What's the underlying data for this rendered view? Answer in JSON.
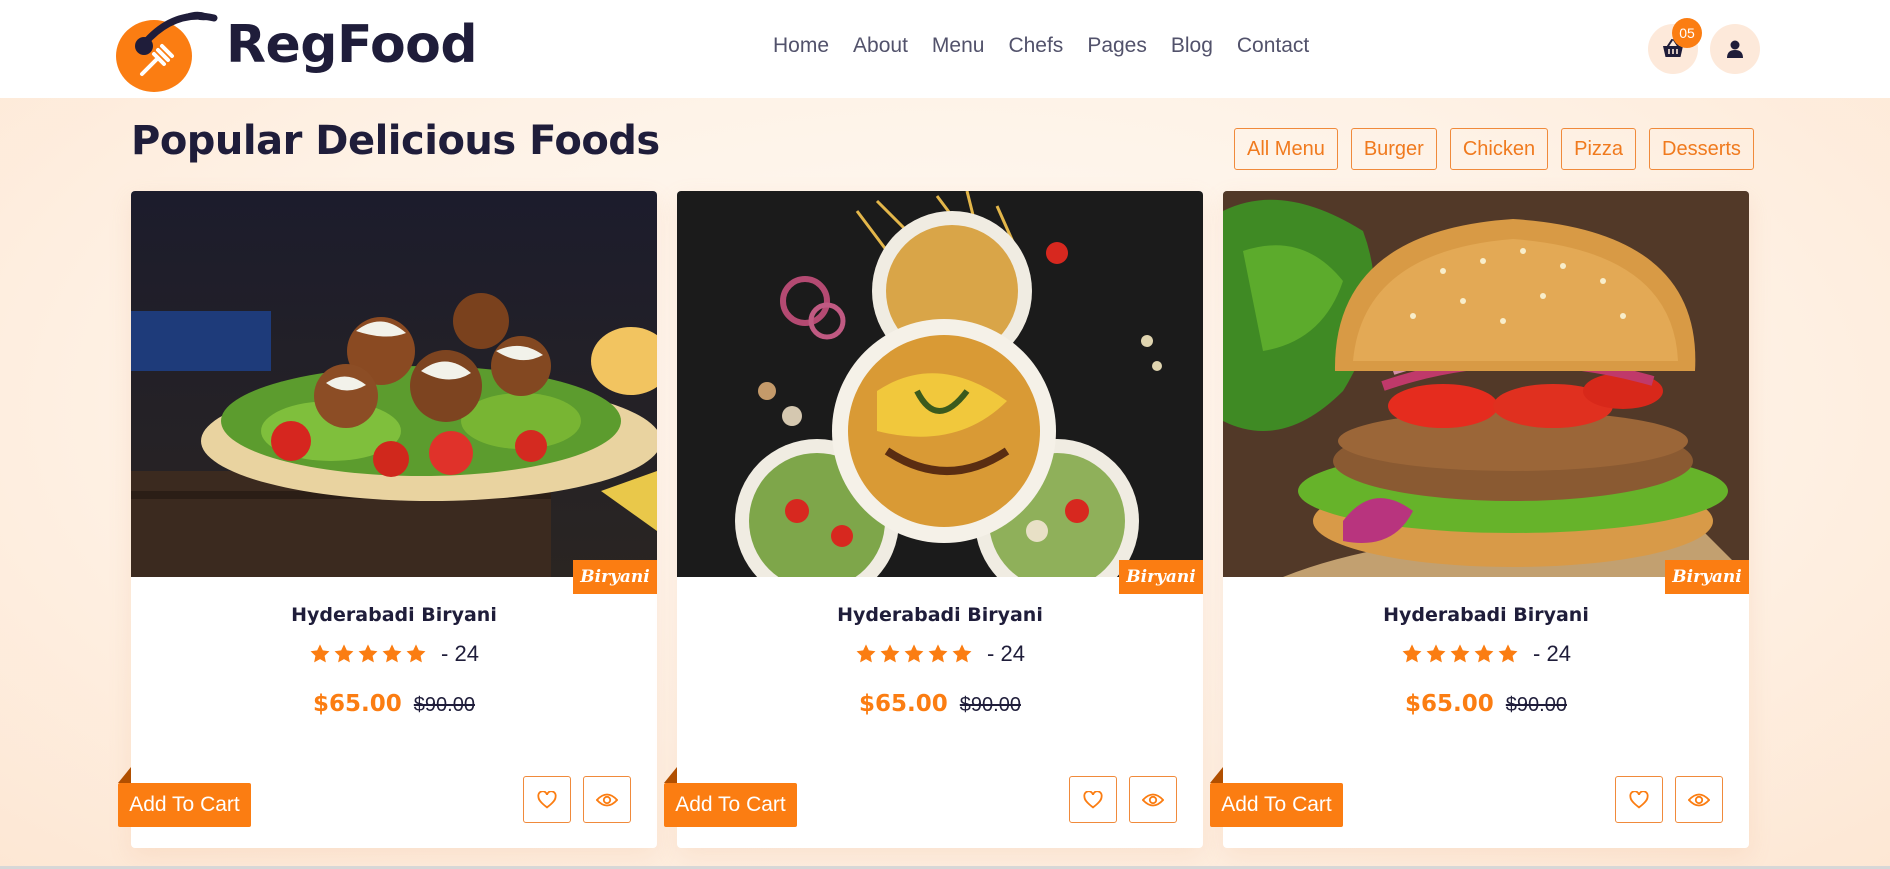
{
  "header": {
    "brand": "RegFood",
    "nav": [
      "Home",
      "About",
      "Menu",
      "Chefs",
      "Pages",
      "Blog",
      "Contact"
    ],
    "cart_count": "05",
    "icons": {
      "cart": "basket-icon",
      "user": "user-icon"
    }
  },
  "section": {
    "title": "Popular Delicious Foods",
    "filters": [
      "All Menu",
      "Burger",
      "Chicken",
      "Pizza",
      "Desserts"
    ]
  },
  "cards": [
    {
      "tag": "Biryani",
      "title": "Hyderabadi Biryani",
      "stars": 5,
      "rating_count": "- 24",
      "price": "$65.00",
      "old_price": "$90.00",
      "cta": "Add To Cart",
      "image": "falafel-wrap"
    },
    {
      "tag": "Biryani",
      "title": "Hyderabadi Biryani",
      "stars": 5,
      "rating_count": "- 24",
      "price": "$65.00",
      "old_price": "$90.00",
      "cta": "Add To Cart",
      "image": "noodle-bowls"
    },
    {
      "tag": "Biryani",
      "title": "Hyderabadi Biryani",
      "stars": 5,
      "rating_count": "- 24",
      "price": "$65.00",
      "old_price": "$90.00",
      "cta": "Add To Cart",
      "image": "burger"
    }
  ],
  "colors": {
    "accent": "#fb7d12",
    "dark": "#1f1d3a",
    "nav": "#52526b"
  }
}
